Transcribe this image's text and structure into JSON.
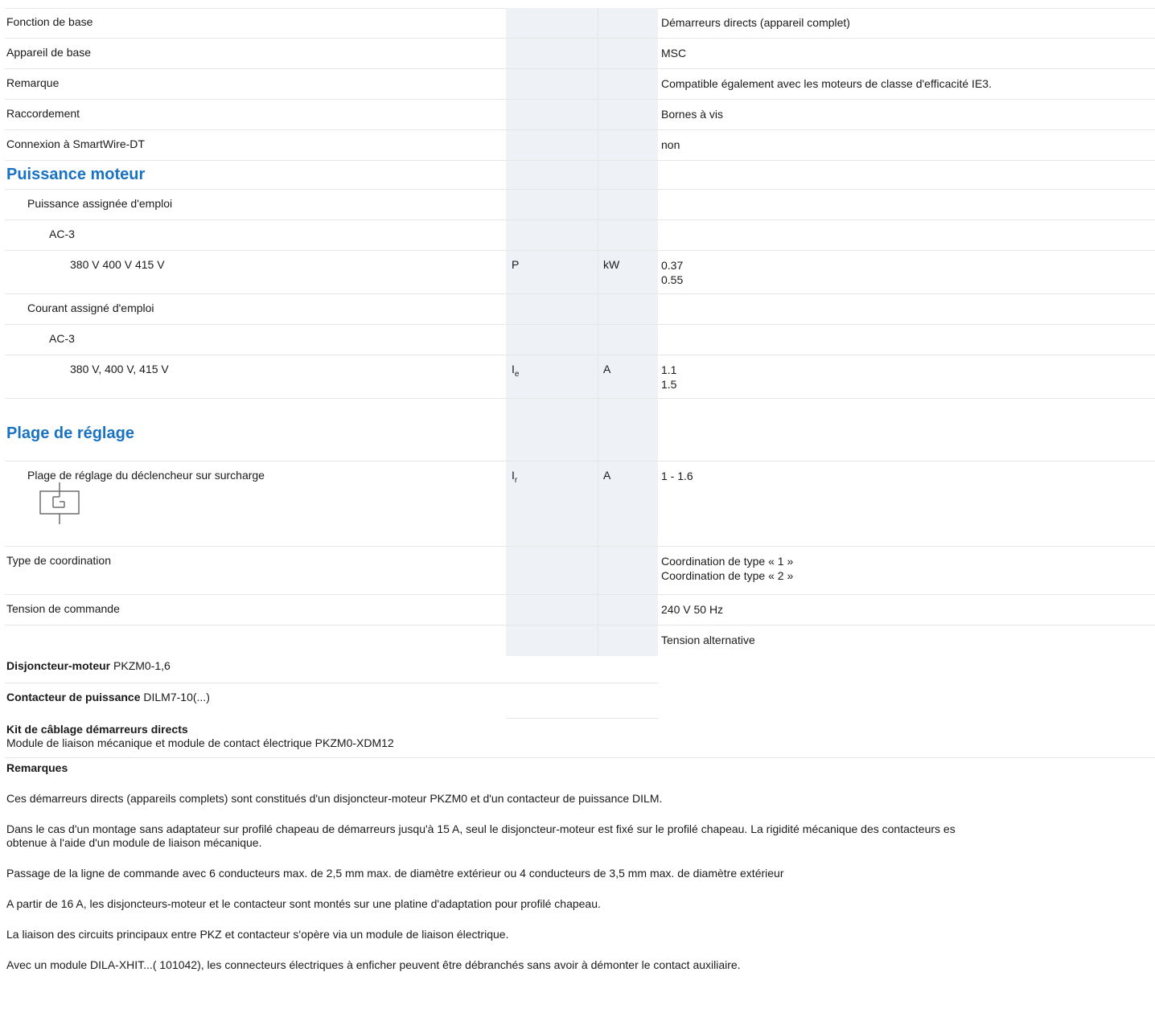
{
  "rows": [
    {
      "label": "Fonction de base",
      "value": "Démarreurs directs (appareil complet)"
    },
    {
      "label": "Appareil de base",
      "value": "MSC"
    },
    {
      "label": "Remarque",
      "value": "Compatible également avec les moteurs de classe d'efficacité IE3."
    },
    {
      "label": "Raccordement",
      "value": "Bornes à vis"
    },
    {
      "label": "Connexion à SmartWire-DT",
      "value": "non"
    }
  ],
  "motor_section": {
    "title": "Puissance moteur",
    "rated_power": "Puissance assignée d'emploi",
    "ac3_a": "AC-3",
    "voltage_power": "380 V 400 V 415 V",
    "power_symbol": "P",
    "power_unit": "kW",
    "power_value_1": "0.37",
    "power_value_2": "0.55",
    "rated_current": "Courant assigné d'emploi",
    "ac3_b": "AC-3",
    "voltage_current": "380 V, 400 V, 415 V",
    "current_symbol": "I",
    "current_symbol_sub": "e",
    "current_unit": "A",
    "current_value_1": "1.1",
    "current_value_2": "1.5"
  },
  "setting_section": {
    "title": "Plage de réglage",
    "overload_label": "Plage de réglage du déclencheur sur surcharge",
    "symbol": "I",
    "symbol_sub": "r",
    "unit": "A",
    "value": "1 - 1.6",
    "icon": "overload-relay-icon"
  },
  "coordination": {
    "label": "Type de coordination",
    "value_1": "Coordination de type « 1 »",
    "value_2": "Coordination de type « 2 »"
  },
  "control_voltage": {
    "label": "Tension de commande",
    "value": "240 V 50 Hz",
    "extra_value": "Tension alternative"
  },
  "components": {
    "breaker_bold": "Disjoncteur-moteur",
    "breaker_ref": "PKZM0-1,6",
    "contactor_bold": "Contacteur de puissance",
    "contactor_ref": "DILM7-10(...)",
    "kit_title": "Kit de câblage démarreurs directs",
    "kit_text": "Module de liaison mécanique et module de contact électrique PKZM0-XDM12"
  },
  "remarks": {
    "title": "Remarques",
    "p1": "Ces démarreurs directs (appareils complets) sont constitués d'un disjoncteur-moteur PKZM0 et d'un contacteur de puissance DILM.",
    "p2_line1": "Dans le cas d'un montage sans adaptateur sur profilé chapeau de démarreurs jusqu'à 15 A, seul le disjoncteur-moteur est fixé sur le profilé chapeau. La rigidité mécanique des contacteurs es",
    "p2_line2": "obtenue à l'aide d'un module de liaison mécanique.",
    "p3": "Passage de la ligne de commande avec 6 conducteurs max. de 2,5 mm max. de diamètre extérieur ou 4 conducteurs de 3,5 mm max. de diamètre extérieur",
    "p4": "A partir de 16 A, les disjoncteurs-moteur et le contacteur sont montés sur une platine d'adaptation pour profilé chapeau.",
    "p5": "La liaison des circuits principaux entre PKZ et contacteur s'opère via un module de liaison électrique.",
    "p6": "Avec un module DILA-XHIT...( 101042), les connecteurs électriques à enficher peuvent être débranchés sans avoir à démonter le contact auxiliaire."
  }
}
